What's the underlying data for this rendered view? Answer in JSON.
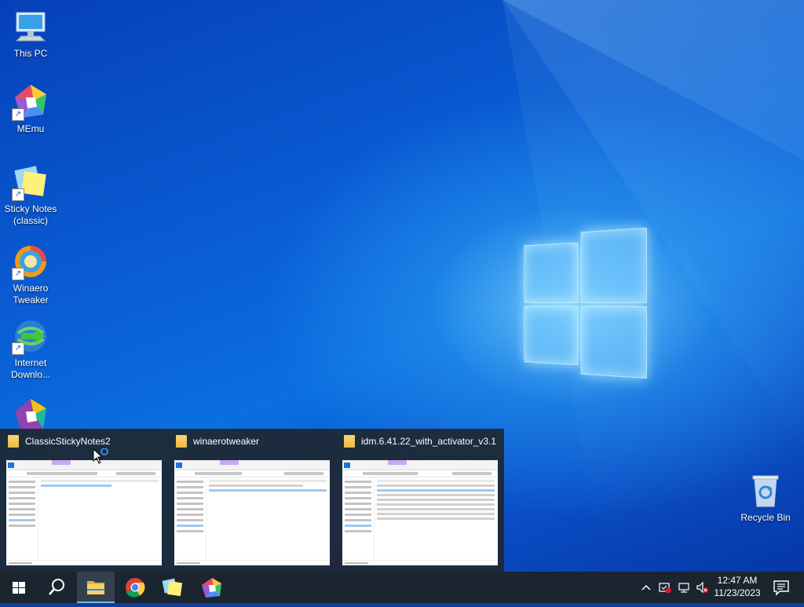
{
  "desktop": {
    "icons": [
      {
        "label": "This PC",
        "icon": "computer-icon"
      },
      {
        "label": "MEmu",
        "icon": "memu-icon"
      },
      {
        "label": "Sticky Notes (classic)",
        "icon": "sticky-notes-icon"
      },
      {
        "label": "Winaero Tweaker",
        "icon": "winaero-icon"
      },
      {
        "label": "Internet Downlo...",
        "icon": "idm-icon"
      },
      {
        "label": "Recycle Bin",
        "icon": "recycle-bin-icon"
      }
    ]
  },
  "thumbnails": [
    {
      "title": "ClassicStickyNotes2",
      "icon": "folder-icon"
    },
    {
      "title": "winaerotweaker",
      "icon": "folder-icon"
    },
    {
      "title": "idm.6.41.22_with_activator_v3.1",
      "icon": "folder-icon"
    }
  ],
  "taskbar": {
    "items": [
      {
        "name": "start",
        "icon": "windows-start-icon"
      },
      {
        "name": "search",
        "icon": "search-icon"
      },
      {
        "name": "file-explorer",
        "icon": "file-explorer-icon",
        "active": true
      },
      {
        "name": "chrome",
        "icon": "chrome-icon"
      },
      {
        "name": "sticky-notes",
        "icon": "sticky-notes-icon"
      },
      {
        "name": "memu",
        "icon": "memu-icon"
      }
    ],
    "tray": {
      "icons": [
        "chevron-up-icon",
        "security-warning-icon",
        "network-icon",
        "volume-muted-icon"
      ],
      "time": "12:47 AM",
      "date": "11/23/2023",
      "notification_icon": "notification-icon"
    }
  },
  "colors": {
    "taskbar": "#1b2530",
    "active_indicator": "#76b9ed",
    "popup": "#1e2832"
  }
}
